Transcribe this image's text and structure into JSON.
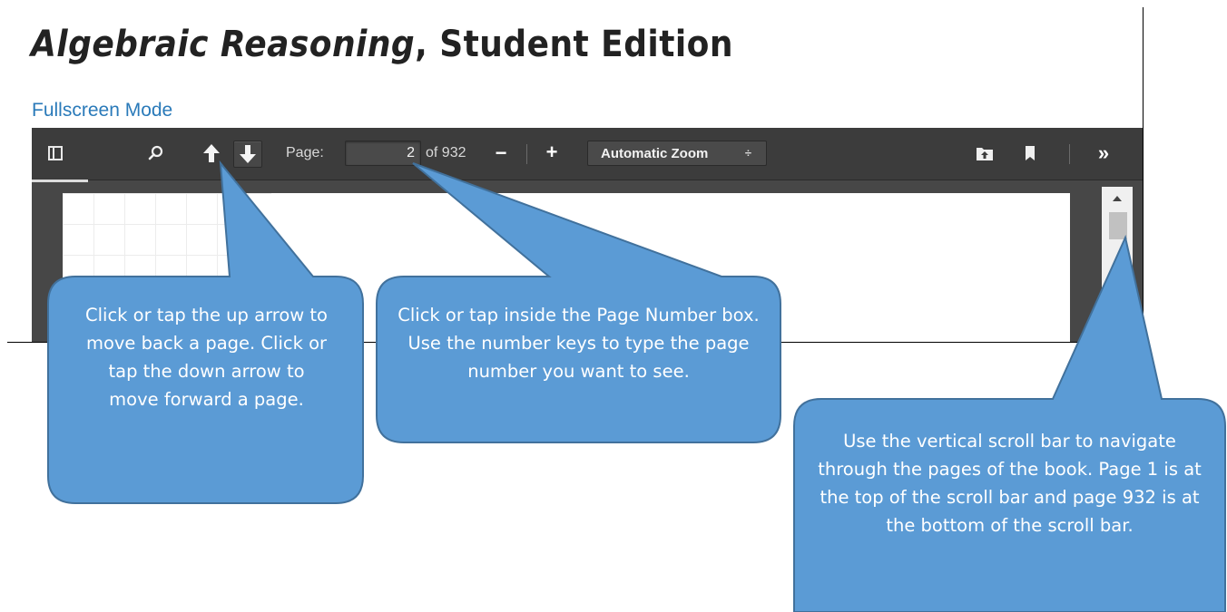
{
  "title": {
    "italic_part": "Algebraic Reasoning",
    "rest": ", Student Edition"
  },
  "fullscreen_link": "Fullscreen Mode",
  "toolbar": {
    "page_label": "Page:",
    "page_value": "2",
    "of_label": "of 932",
    "zoom_out": "−",
    "zoom_in": "+",
    "zoom_value": "Automatic Zoom",
    "zoom_caret": "÷",
    "tools": "»"
  },
  "icons": [
    "sidebar-icon",
    "search-icon",
    "arrow-up-icon",
    "arrow-down-icon",
    "open-file-icon",
    "bookmark-icon",
    "tools-icon"
  ],
  "colors": {
    "callout_fill": "#5b9bd5",
    "callout_border": "#41719c",
    "link": "#2a7ab9",
    "toolbar": "#3c3c3c"
  },
  "callouts": {
    "arrows": "Click or tap the up arrow to move back a page. Click or tap the down arrow to move forward a page.",
    "page_box": "Click or tap inside the Page Number box. Use the number keys to type the page number you want to see.",
    "scroll": "Use the vertical scroll bar to navigate through the pages of the book. Page 1 is at the top of the scroll bar and page 932 is at the bottom of the scroll bar."
  }
}
